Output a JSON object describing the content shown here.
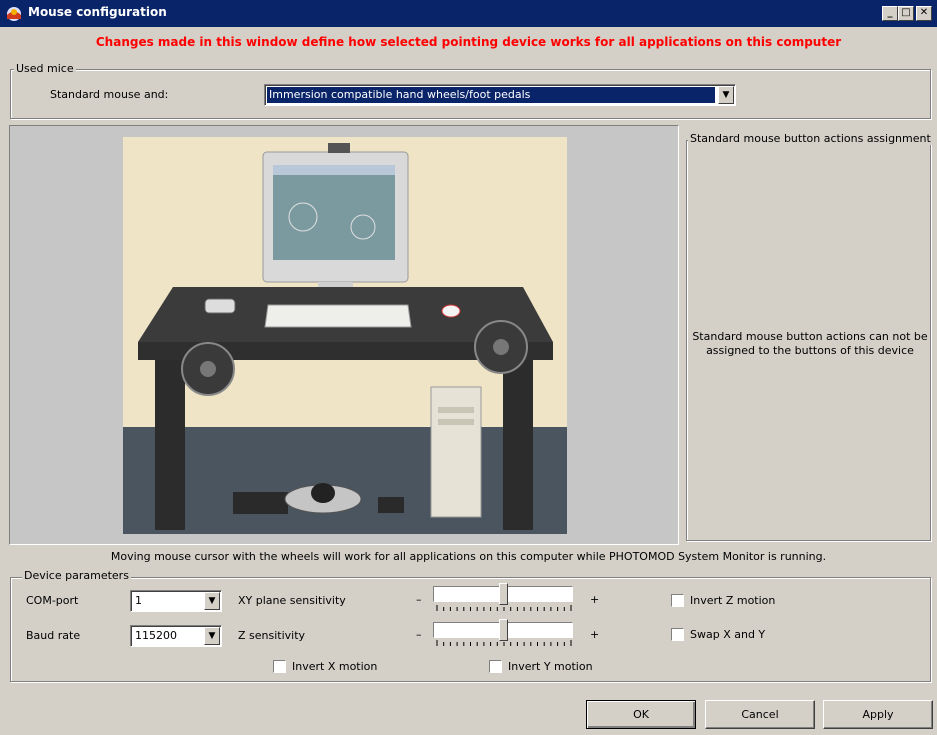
{
  "window": {
    "title": "Mouse configuration",
    "icon": "app-icon",
    "controls": [
      "minimize-icon",
      "maximize-icon",
      "close-icon"
    ]
  },
  "warning": "Changes made in this window define how selected pointing device works for all applications on this computer",
  "used_mice": {
    "group_label": "Used mice",
    "label": "Standard mouse and:",
    "selected": "Immersion compatible hand wheels/foot pedals"
  },
  "assignment": {
    "group_label": "Standard mouse button actions assignment",
    "message": "Standard mouse button actions can not be assigned to the buttons of this device"
  },
  "info_text": "Moving mouse cursor with the wheels will work for all applications on this computer while PHOTOMOD System Monitor is running.",
  "device": {
    "group_label": "Device parameters",
    "com_port_label": "COM-port",
    "com_port_value": "1",
    "baud_rate_label": "Baud rate",
    "baud_rate_value": "115200",
    "xy_label": "XY plane sensitivity",
    "z_label": "Z sensitivity",
    "minus": "–",
    "plus": "+",
    "xy_level": 0.5,
    "z_level": 0.5,
    "invert_z": "Invert Z motion",
    "swap_xy": "Swap X and Y",
    "invert_x": "Invert X motion",
    "invert_y": "Invert Y motion"
  },
  "buttons": {
    "ok": "OK",
    "cancel": "Cancel",
    "apply": "Apply"
  },
  "colors": {
    "titlebar": "#0a246a",
    "warning": "#ff0000",
    "face": "#d4d0c8"
  }
}
